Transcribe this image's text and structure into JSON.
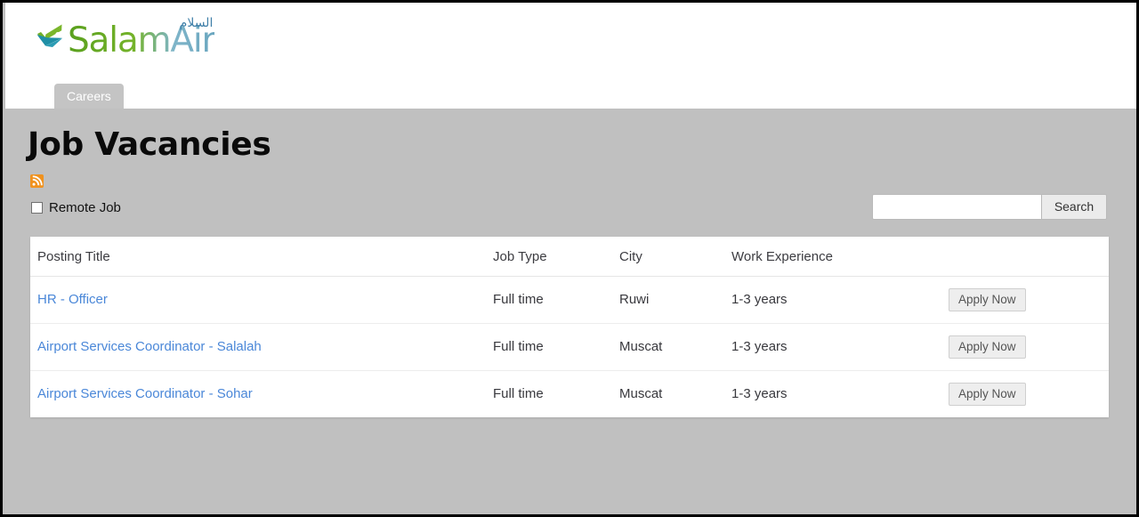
{
  "brand": {
    "name": "SalamAir",
    "arabic": "السلام",
    "logo_icon": "salamair-swoosh-icon",
    "green": "#6ab023",
    "teal": "#2f93a8",
    "arabic_color": "#3f7fa8"
  },
  "nav": {
    "tabs": [
      {
        "label": "Careers",
        "active": true
      }
    ]
  },
  "page": {
    "title": "Job Vacancies",
    "rss_icon": "rss-feed-icon",
    "rss_color": "#f0921e"
  },
  "filters": {
    "remote": {
      "label": "Remote Job",
      "checked": false
    }
  },
  "search": {
    "value": "",
    "placeholder": "",
    "button_label": "Search"
  },
  "table": {
    "columns": [
      "Posting Title",
      "Job Type",
      "City",
      "Work Experience",
      ""
    ],
    "rows": [
      {
        "title": "HR - Officer",
        "job_type": "Full time",
        "city": "Ruwi",
        "experience": "1-3 years",
        "action": "Apply Now"
      },
      {
        "title": "Airport Services Coordinator - Salalah",
        "job_type": "Full time",
        "city": "Muscat",
        "experience": "1-3 years",
        "action": "Apply Now"
      },
      {
        "title": "Airport Services Coordinator - Sohar",
        "job_type": "Full time",
        "city": "Muscat",
        "experience": "1-3 years",
        "action": "Apply Now"
      }
    ]
  },
  "colors": {
    "page_background": "#c0c0c0",
    "header_background": "#ffffff",
    "tab_background": "#c4c4c4",
    "link": "#4a87d8",
    "table_background": "#ffffff"
  }
}
